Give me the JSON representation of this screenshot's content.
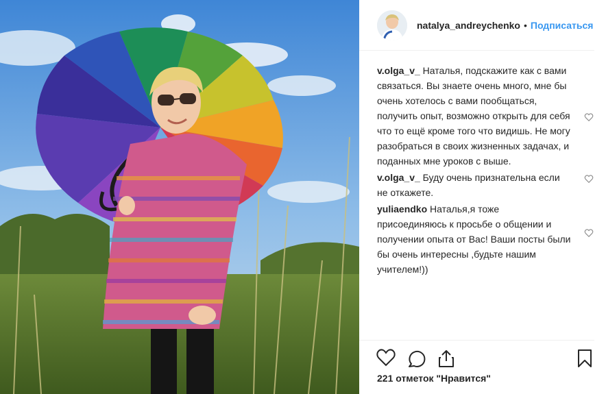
{
  "header": {
    "username": "natalya_andreychenko",
    "separator": "•",
    "follow_label": "Подписаться"
  },
  "comments": [
    {
      "user": "v.olga_v_",
      "text": "Наталья, подскажите как с вами связаться. Вы знаете очень много, мне бы очень хотелось с вами пообщаться, получить опыт, возможно открыть для себя что то ещё кроме того что видишь. Не могу разобраться в своих жизненных задачах, и поданных мне уроков с выше."
    },
    {
      "user": "v.olga_v_",
      "text": "Буду очень признательна если не откажете."
    },
    {
      "user": "yuliaendko",
      "text": "Наталья,я тоже присоединяюсь к просьбе о общении и получении опыта от Вас! Ваши посты были бы очень интересны ,будьте нашим учителем!))"
    }
  ],
  "likes": {
    "text": "221 отметок \"Нравится\""
  },
  "icons": {
    "like": "heart-icon",
    "comment": "comment-icon",
    "share": "share-icon",
    "save": "bookmark-icon",
    "comment_like": "small-heart-icon"
  },
  "colors": {
    "link": "#3897f0",
    "text": "#262626",
    "divider": "#efefef"
  }
}
